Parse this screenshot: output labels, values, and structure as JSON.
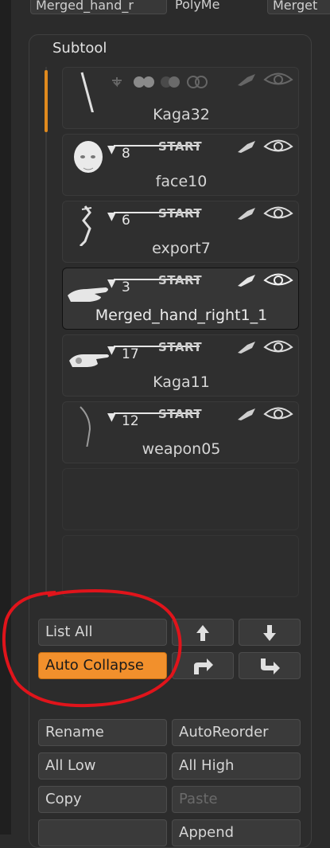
{
  "topbar": {
    "left": "Merged_hand_r",
    "middle": "PolyMe",
    "right": "Merget"
  },
  "panel": {
    "title": "Subtool"
  },
  "subtools": [
    {
      "name": "Kaga32",
      "count": "",
      "start": "",
      "thumb": "stick-icon",
      "collapsed": true
    },
    {
      "name": "face10",
      "count": "8",
      "start": "START",
      "thumb": "head-icon"
    },
    {
      "name": "export7",
      "count": "6",
      "start": "START",
      "thumb": "figure-icon"
    },
    {
      "name": "Merged_hand_right1_1",
      "count": "3",
      "start": "START",
      "thumb": "hand-icon",
      "selected": true
    },
    {
      "name": "Kaga11",
      "count": "17",
      "start": "START",
      "thumb": "hand-point-icon"
    },
    {
      "name": "weapon05",
      "count": "12",
      "start": "START",
      "thumb": "blade-icon"
    }
  ],
  "buttons": {
    "list_all": "List All",
    "auto_collapse": "Auto Collapse",
    "rename": "Rename",
    "auto_reorder": "AutoReorder",
    "all_low": "All Low",
    "all_high": "All High",
    "copy": "Copy",
    "paste": "Paste",
    "append": "Append"
  },
  "colors": {
    "accent": "#f2902c",
    "annotation": "#e0141b"
  }
}
